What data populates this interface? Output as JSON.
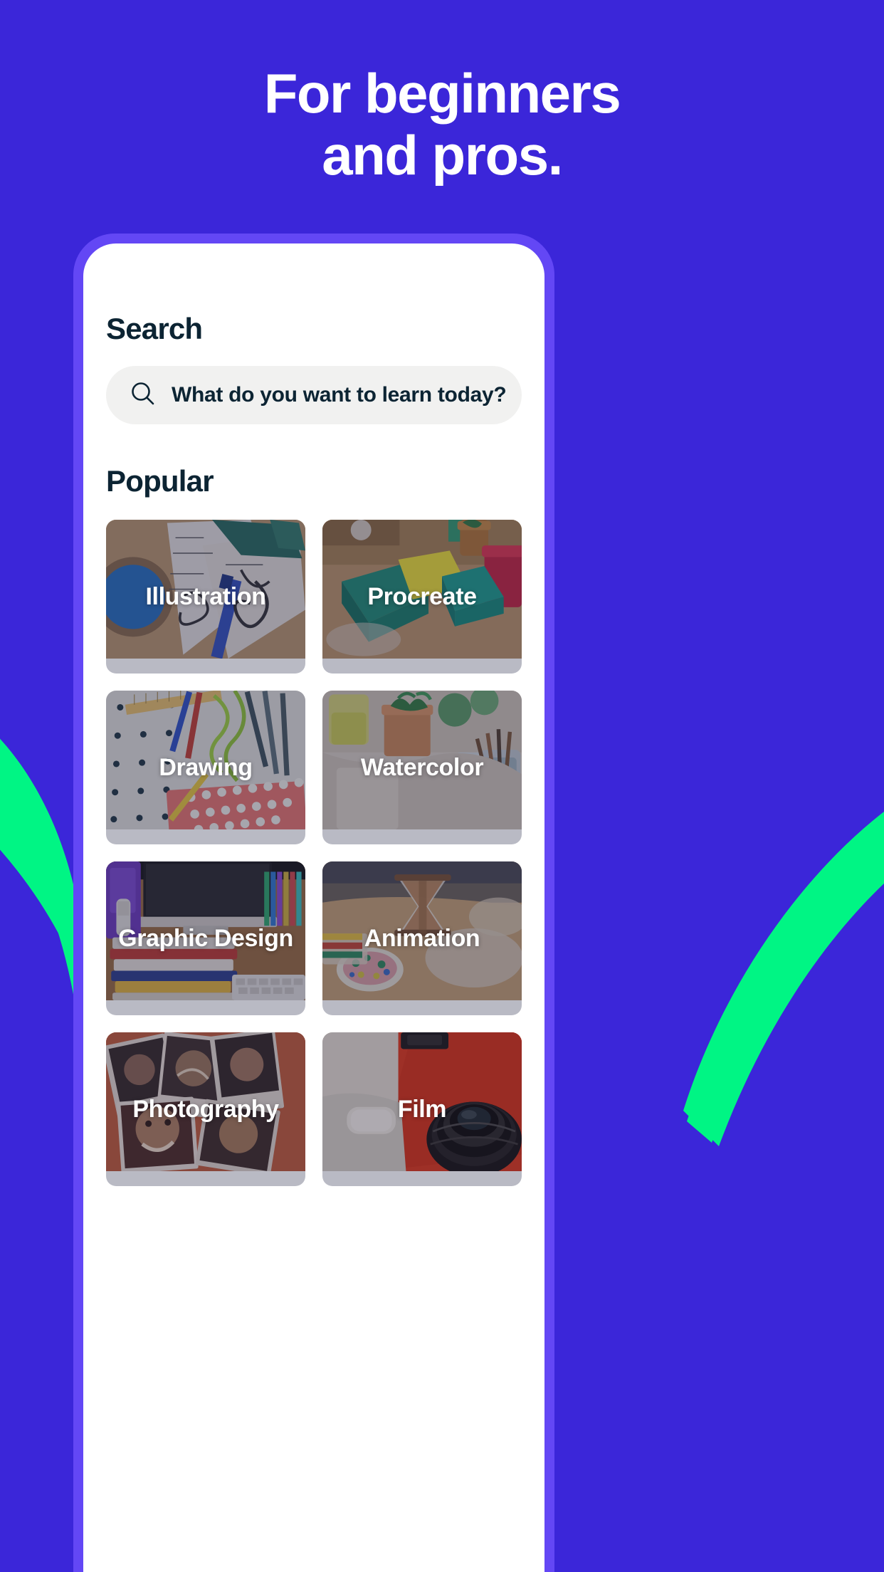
{
  "theme": {
    "background": "#3B26D9",
    "phone_bezel": "#6347F5",
    "accent_green": "#00F584",
    "text_dark": "#0C2433",
    "search_field_bg": "#F1F1F0",
    "card_label_color": "#FFFFFF"
  },
  "headline": {
    "line1": "For beginners",
    "line2": "and pros."
  },
  "screen": {
    "search_heading": "Search",
    "search": {
      "placeholder": "What do you want to learn today?",
      "value": "",
      "icon": "search-icon"
    },
    "popular_heading": "Popular",
    "categories": [
      {
        "label": "Illustration"
      },
      {
        "label": "Procreate"
      },
      {
        "label": "Drawing"
      },
      {
        "label": "Watercolor"
      },
      {
        "label": "Graphic Design"
      },
      {
        "label": "Animation"
      },
      {
        "label": "Photography"
      },
      {
        "label": "Film"
      }
    ]
  }
}
